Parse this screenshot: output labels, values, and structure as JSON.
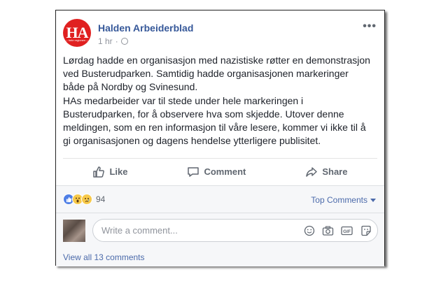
{
  "post": {
    "page_name": "Halden Arbeiderblad",
    "avatar_text": "HA",
    "avatar_subtext": "— hele regionen —",
    "timestamp": "1 hr",
    "separator": "·",
    "more_glyph": "•••",
    "paragraphs": [
      "Lørdag hadde en organisasjon med nazistiske røtter en demonstrasjon\nved Busterudparken. Samtidig hadde organisasjonen markeringer\nbåde på Nordby og Svinesund.",
      "HAs medarbeider var til stede under hele markeringen i\nBusterudparken, for å observere hva som skjedde. Utover denne\nmeldingen, som en ren informasjon til våre lesere, kommer vi ikke til å\ngi organisasjonen og dagens hendelse ytterligere publisitet."
    ]
  },
  "actions": {
    "like_label": "Like",
    "comment_label": "Comment",
    "share_label": "Share"
  },
  "reactions": {
    "icons": [
      "like-icon",
      "wow-icon",
      "sad-icon"
    ],
    "count": "94",
    "sort_label": "Top Comments"
  },
  "comments": {
    "placeholder": "Write a comment...",
    "icons": [
      "emoji-icon",
      "camera-icon",
      "gif-icon",
      "sticker-icon"
    ],
    "gif_text": "GIF",
    "view_all_label": "View all 13 comments"
  },
  "colors": {
    "link": "#365899",
    "brand_red": "#e02020",
    "like_blue": "#4f7fe6",
    "muted": "#606770"
  }
}
